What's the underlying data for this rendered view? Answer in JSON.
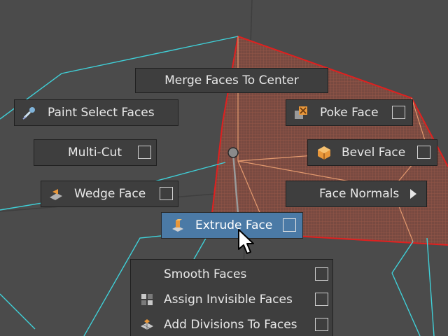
{
  "marking_menu": {
    "merge_faces_to_center": "Merge Faces To Center",
    "paint_select_faces": "Paint Select Faces",
    "poke_face": "Poke Face",
    "multi_cut": "Multi-Cut",
    "bevel_face": "Bevel Face",
    "wedge_face": "Wedge Face",
    "face_normals": "Face Normals",
    "extrude_face": "Extrude Face"
  },
  "overflow_list": [
    {
      "label": "Smooth Faces",
      "icon": ""
    },
    {
      "label": "Assign Invisible Faces",
      "icon": "invisible-faces-icon"
    },
    {
      "label": "Add Divisions To Faces",
      "icon": "add-divisions-icon"
    }
  ],
  "colors": {
    "viewport_bg": "#4b4b4b",
    "wireframe": "#3fd0d8",
    "selection_edge": "#e0201f",
    "selected_face": "#8a4a3f",
    "active_item": "#4b7aa6",
    "menu_bg": "#3e3e3e",
    "icon_orange": "#e8973a"
  }
}
